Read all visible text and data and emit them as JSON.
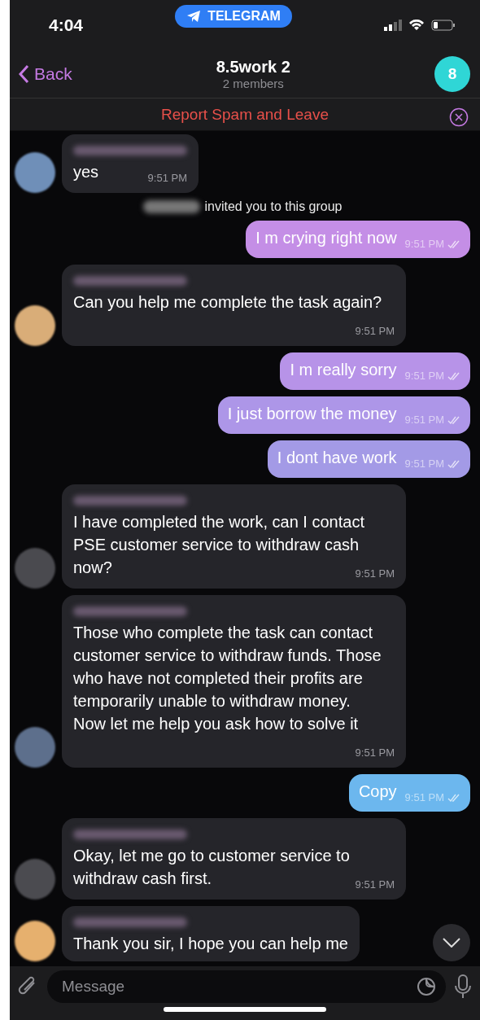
{
  "status_bar": {
    "time": "4:04",
    "app_pill": "TELEGRAM"
  },
  "header": {
    "back": "Back",
    "title": "8.5work 2",
    "subtitle": "2 members",
    "avatar_letter": "8"
  },
  "report_bar": {
    "label": "Report Spam and Leave"
  },
  "messages": [
    {
      "kind": "incoming",
      "text": "yes",
      "time": "9:51 PM",
      "avatar": {
        "color": "#6f8fb8"
      }
    },
    {
      "kind": "service",
      "text": "invited you to this group"
    },
    {
      "kind": "outgoing",
      "text": "I m crying right now",
      "time": "9:51 PM",
      "color": "#c48ee6"
    },
    {
      "kind": "incoming",
      "text": "Can you help me complete the task again?",
      "time": "9:51 PM",
      "avatar": {
        "color": "#d9ad78"
      }
    },
    {
      "kind": "outgoing",
      "text": "I m really sorry",
      "time": "9:51 PM",
      "color": "#b793e8"
    },
    {
      "kind": "outgoing",
      "text": "I just borrow the money",
      "time": "9:51 PM",
      "color": "#ad96e8"
    },
    {
      "kind": "outgoing",
      "text": "I dont have work",
      "time": "9:51 PM",
      "color": "#a39ae6"
    },
    {
      "kind": "incoming",
      "text": "I have completed the work, can I contact PSE customer service to withdraw cash now?",
      "time": "9:51 PM",
      "avatar": {
        "color": "#4a4a4f"
      }
    },
    {
      "kind": "incoming",
      "text": "Those who complete the task can contact customer service to withdraw funds. Those who have not completed their profits are temporarily unable to withdraw money.\nNow let me help you ask how to solve it",
      "time": "9:51 PM",
      "avatar": {
        "color": "#5d6f8c"
      }
    },
    {
      "kind": "outgoing",
      "text": "Copy",
      "time": "9:51 PM",
      "color": "#6cb7ee"
    },
    {
      "kind": "incoming",
      "text": "Okay, let me go to customer service to withdraw cash first.",
      "time": "9:51 PM",
      "avatar": {
        "color": "#4b4b50"
      }
    },
    {
      "kind": "incoming",
      "text": "Thank you sir, I hope you can help me",
      "avatar": {
        "color": "#e6b06e"
      }
    }
  ],
  "composer": {
    "placeholder": "Message"
  }
}
